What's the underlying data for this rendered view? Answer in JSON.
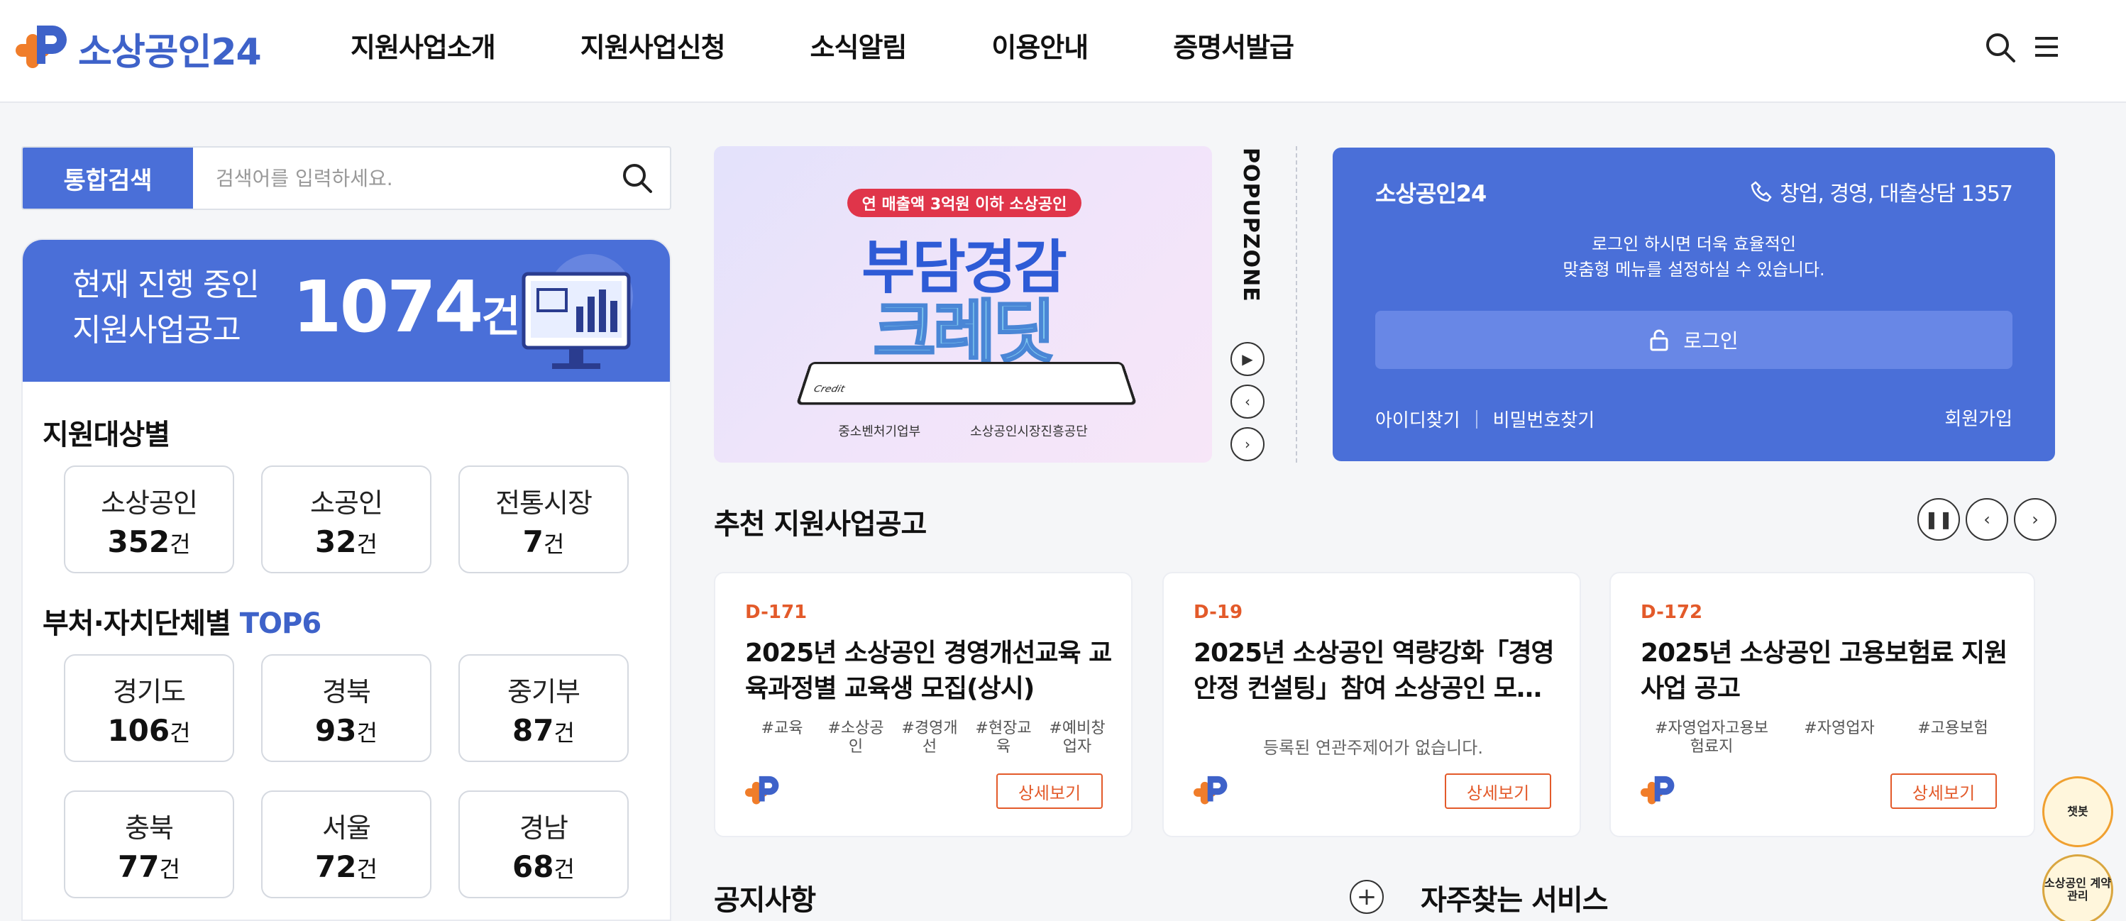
{
  "header": {
    "logo_text": "소상공인24",
    "nav": [
      "지원사업소개",
      "지원사업신청",
      "소식알림",
      "이용안내",
      "증명서발급"
    ]
  },
  "search": {
    "tag": "통합검색",
    "placeholder": "검색어를 입력하세요."
  },
  "status": {
    "label_line1": "현재 진행 중인",
    "label_line2": "지원사업공고",
    "count": "1074",
    "unit": "건"
  },
  "by_target": {
    "title": "지원대상별",
    "items": [
      {
        "name": "소상공인",
        "count": "352",
        "unit": "건"
      },
      {
        "name": "소공인",
        "count": "32",
        "unit": "건"
      },
      {
        "name": "전통시장",
        "count": "7",
        "unit": "건"
      }
    ]
  },
  "by_region": {
    "title_prefix": "부처·자치단체별",
    "title_highlight": "TOP6",
    "items": [
      {
        "name": "경기도",
        "count": "106",
        "unit": "건"
      },
      {
        "name": "경북",
        "count": "93",
        "unit": "건"
      },
      {
        "name": "중기부",
        "count": "87",
        "unit": "건"
      },
      {
        "name": "충북",
        "count": "77",
        "unit": "건"
      },
      {
        "name": "서울",
        "count": "72",
        "unit": "건"
      },
      {
        "name": "경남",
        "count": "68",
        "unit": "건"
      }
    ]
  },
  "banner": {
    "pill": "연 매출액 3억원 이하 소상공인",
    "title1": "부담경감",
    "title2": "크레딧",
    "card_text": "Credit",
    "org1": "중소벤처기업부",
    "org2": "소상공인시장진흥공단"
  },
  "popup": {
    "label": "POPUPZONE"
  },
  "login": {
    "brand": "소상공인24",
    "phone": "창업, 경영, 대출상담 1357",
    "msg_line1": "로그인 하시면 더욱 효율적인",
    "msg_line2": "맞춤형 메뉴를 설정하실 수 있습니다.",
    "button": "로그인",
    "find_id": "아이디찾기",
    "find_pw": "비밀번호찾기",
    "join": "회원가입"
  },
  "recommend": {
    "title": "추천 지원사업공고",
    "detail_label": "상세보기",
    "cards": [
      {
        "dday": "D-171",
        "title": "2025년 소상공인 경영개선교육 교육과정별 교육생 모집(상시)",
        "tags": [
          "#교육",
          "#소상공인",
          "#경영개선",
          "#현장교육",
          "#예비창업자"
        ]
      },
      {
        "dday": "D-19",
        "title": "2025년 소상공인 역량강화「경영안정 컨설팅」참여 소상공인 모…",
        "notag": "등록된 연관주제어가 없습니다."
      },
      {
        "dday": "D-172",
        "title": "2025년 소상공인 고용보험료 지원사업 공고",
        "tags": [
          "#자영업자고용보험료지",
          "#자영업자",
          "#고용보험"
        ]
      }
    ]
  },
  "notice": {
    "title": "공지사항"
  },
  "faq": {
    "title": "자주찾는 서비스"
  },
  "floating": {
    "chatbot": "챗봇",
    "contract": "소상공인 계약관리"
  },
  "colors": {
    "brand_blue": "#4a6fd8",
    "accent_orange": "#e35a2a",
    "logo_orange": "#f07d2a"
  }
}
